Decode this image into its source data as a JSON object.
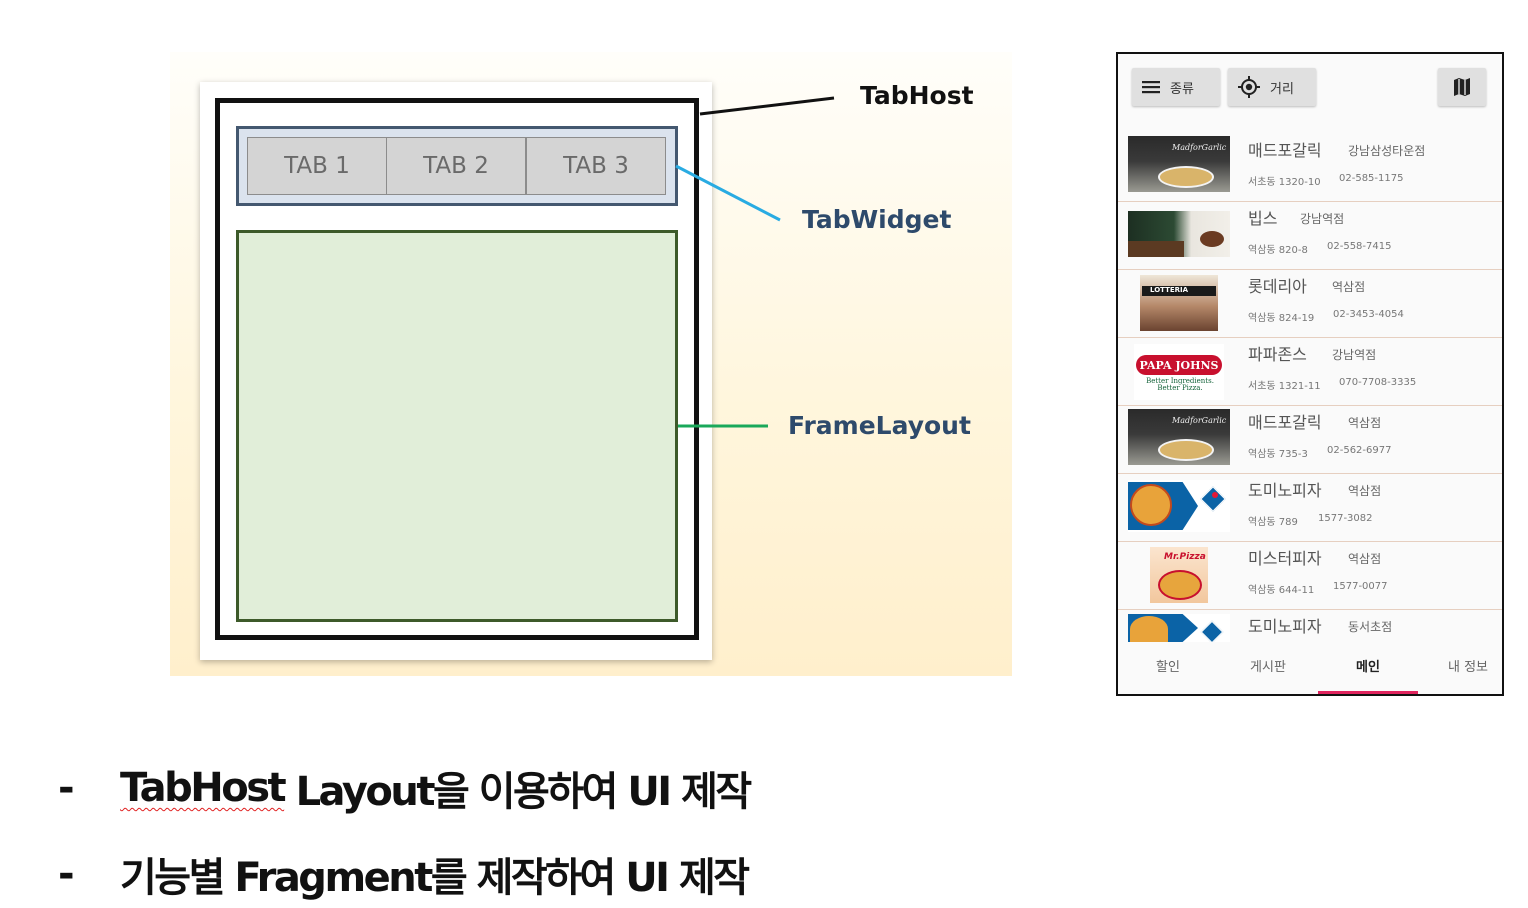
{
  "diagram": {
    "tabs": [
      "TAB 1",
      "TAB 2",
      "TAB 3"
    ],
    "labels": {
      "tabhost": "TabHost",
      "tabwidget": "TabWidget",
      "framelayout": "FrameLayout"
    },
    "colors": {
      "tabhost_line": "#111111",
      "tabwidget_line": "#29abe2",
      "framelayout_line": "#1aa85a",
      "tabwidget_label": "#2e4a6b",
      "framelayout_label": "#2e4a6b",
      "frame_fill": "#e1eed9"
    }
  },
  "phone": {
    "toolbar": {
      "category_label": "종류",
      "category_icon": "menu-icon",
      "distance_label": "거리",
      "distance_icon": "gps-icon",
      "map_icon": "map-icon"
    },
    "restaurants": [
      {
        "name": "매드포갈릭",
        "branch": "강남삼성타운점",
        "address": "서초동 1320-10",
        "phone": "02-585-1175",
        "thumb": "madforgarlic-logo"
      },
      {
        "name": "빕스",
        "branch": "강남역점",
        "address": "역삼동 820-8",
        "phone": "02-558-7415",
        "thumb": "vips-photo"
      },
      {
        "name": "롯데리아",
        "branch": "역삼점",
        "address": "역삼동 824-19",
        "phone": "02-3453-4054",
        "thumb": "lotteria-photo",
        "thumb_text": "LOTTERIA"
      },
      {
        "name": "파파존스",
        "branch": "강남역점",
        "address": "서초동 1321-11",
        "phone": "070-7708-3335",
        "thumb": "papajohns-logo",
        "thumb_text": "PAPA JOHNS",
        "thumb_sub": "Better Ingredients. Better Pizza."
      },
      {
        "name": "매드포갈릭",
        "branch": "역삼점",
        "address": "역삼동 735-3",
        "phone": "02-562-6977",
        "thumb": "madforgarlic-logo"
      },
      {
        "name": "도미노피자",
        "branch": "역삼점",
        "address": "역삼동 789",
        "phone": "1577-3082",
        "thumb": "dominos-logo"
      },
      {
        "name": "미스터피자",
        "branch": "역삼점",
        "address": "역삼동 644-11",
        "phone": "1577-0077",
        "thumb": "mrpizza-logo",
        "thumb_text": "Mr.Pizza"
      },
      {
        "name": "도미노피자",
        "branch": "동서초점",
        "address": "",
        "phone": "",
        "thumb": "dominos-logo"
      }
    ],
    "bottom_tabs": [
      "할인",
      "게시판",
      "메인",
      "내 정보"
    ],
    "active_tab": "메인",
    "accent": "#e0245e"
  },
  "bullets": [
    {
      "dash": "-",
      "text_a": "TabHost",
      "text_b": " Layout을 이용하여 UI 제작"
    },
    {
      "dash": "-",
      "text_a": "",
      "text_b": "기능별 Fragment를 제작하여 UI 제작"
    }
  ]
}
